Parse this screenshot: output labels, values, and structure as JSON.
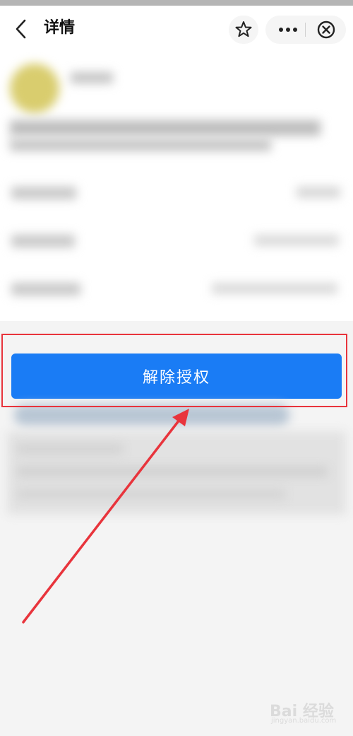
{
  "navbar": {
    "title": "详情",
    "back_icon": "chevron-left-icon",
    "favorite_icon": "star-outline-icon",
    "more_icon": "more-dots-icon",
    "close_icon": "close-circle-icon"
  },
  "main": {
    "unauthorize_button_label": "解除授权"
  },
  "annotation": {
    "highlight_color": "#e8343c",
    "arrow_color": "#e8343c"
  },
  "watermark": {
    "text": "Bai 经验",
    "subtext": "jingyan.baidu.com"
  },
  "colors": {
    "primary_button": "#1a7cf5",
    "page_background": "#f4f4f4"
  }
}
